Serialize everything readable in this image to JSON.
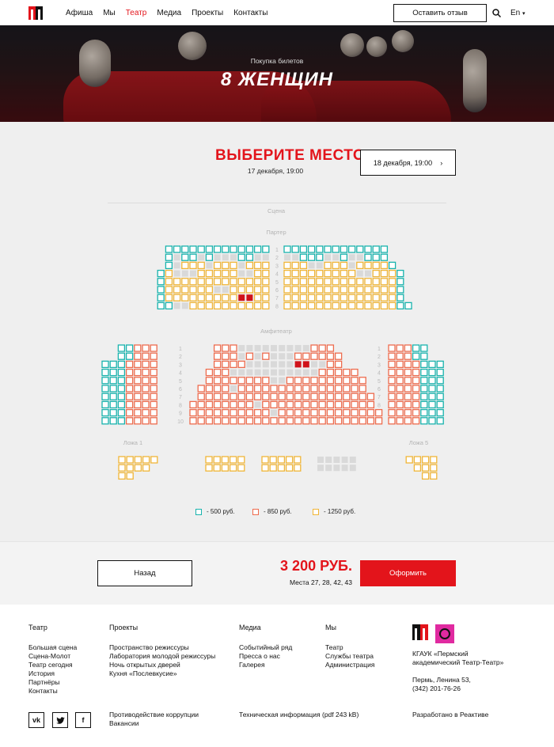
{
  "header": {
    "nav": [
      {
        "label": "Афиша",
        "active": false
      },
      {
        "label": "Мы",
        "active": false
      },
      {
        "label": "Театр",
        "active": true
      },
      {
        "label": "Медиа",
        "active": false
      },
      {
        "label": "Проекты",
        "active": false
      },
      {
        "label": "Контакты",
        "active": false
      }
    ],
    "review_button": "Оставить отзыв",
    "lang": "En"
  },
  "hero": {
    "subtitle": "Покупка билетов",
    "title": "8 ЖЕНЩИН"
  },
  "selection": {
    "title": "ВЫБЕРИТЕ МЕСТО",
    "date": "17 декабря, 19:00",
    "next_date_button": "18 декабря, 19:00"
  },
  "hall": {
    "stage_label": "Сцена",
    "parter_label": "Партер",
    "amphi_label": "Амфитеатр",
    "lozha1_label": "Ложа 1",
    "lozha5_label": "Ложа 5",
    "parter_rows": [
      "1",
      "2",
      "3",
      "4",
      "5",
      "6",
      "7",
      "8"
    ],
    "amphi_rows": [
      "1",
      "2",
      "3",
      "4",
      "5",
      "6",
      "7",
      "8",
      "9",
      "10"
    ]
  },
  "legend": [
    {
      "price": "-  500 руб.",
      "color": "#18b3ad"
    },
    {
      "price": "-  850 руб.",
      "color": "#ee6b4d"
    },
    {
      "price": "-  1250 руб.",
      "color": "#f0b537"
    }
  ],
  "colors": {
    "accent": "#e3141b",
    "teal": "#18b3ad",
    "orange": "#ee6b4d",
    "yellow": "#f0b537",
    "taken": "#d9d9d9",
    "selected": "#d0121a"
  },
  "summary": {
    "back_button": "Назад",
    "price": "3 200 РУБ.",
    "places": "Места 27, 28, 42, 43",
    "order_button": "Оформить"
  },
  "footer": {
    "columns": [
      {
        "title": "Театр",
        "items": [
          "Большая сцена",
          "Сцена-Молот",
          "Театр сегодня",
          "История",
          "Партнёры",
          "Контакты"
        ]
      },
      {
        "title": "Проекты",
        "items": [
          "Пространство режиссуры",
          "Лаборатория молодой режиссуры",
          "Ночь открытых дверей",
          "Кухня «Послевкусие»"
        ]
      },
      {
        "title": "Медиа",
        "items": [
          "Событийный ряд",
          "Пресса о нас",
          "Галерея"
        ]
      },
      {
        "title": "Мы",
        "items": [
          "Театр",
          "Службы театра",
          "Администрация"
        ]
      }
    ],
    "org_line1": "КГАУК «Пермский",
    "org_line2": "академический Театр-Театр»",
    "address_line1": "Пермь, Ленина 53,",
    "address_line2": "(342) 201-76-26",
    "anticorruption": "Противодействие коррупции",
    "vacancies": "Вакансии",
    "tech_info": "Техническая информация (pdf 243 kB)",
    "developed": "Разработано в Реактиве",
    "social": [
      "vk",
      "twitter",
      "facebook"
    ]
  }
}
